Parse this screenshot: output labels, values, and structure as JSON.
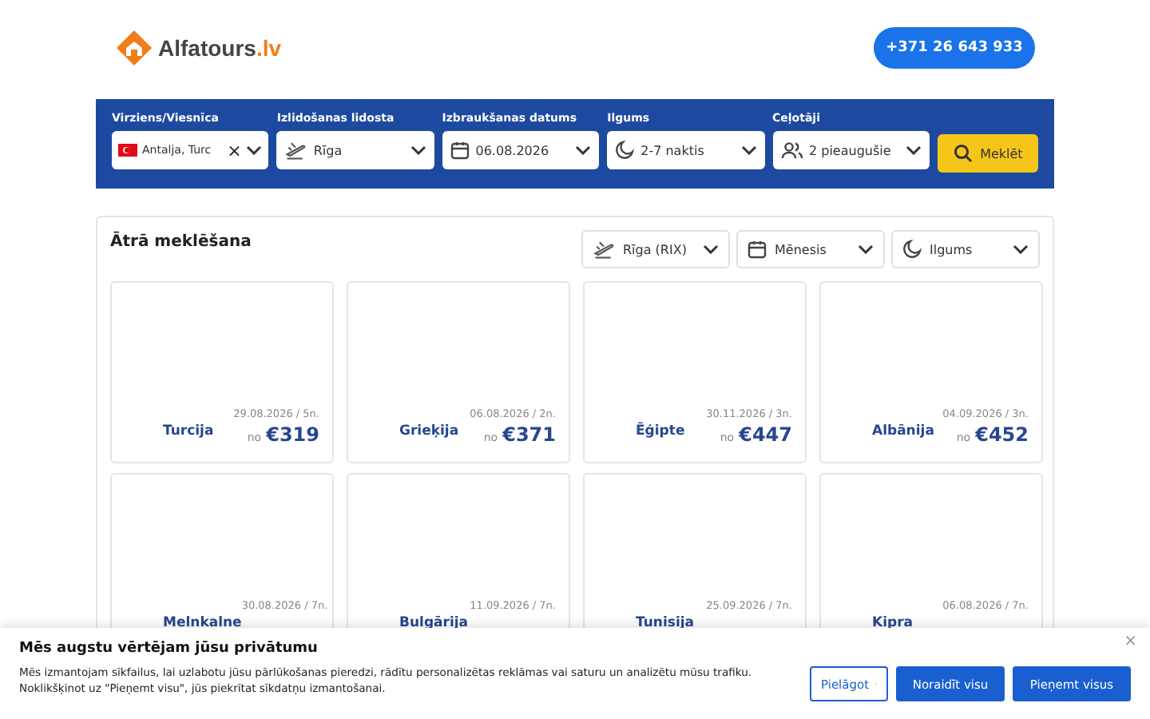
{
  "header": {
    "logo": {
      "name": "Alfatours",
      "suffix": ".lv"
    },
    "phone_button": "+371 26 643 933"
  },
  "search": {
    "fields": [
      {
        "kind": "destination",
        "label": "Virziens/Viesnīca",
        "value": "Antalja, Turc",
        "clear": "×"
      },
      {
        "kind": "airport",
        "label": "Izlidošanas lidosta",
        "value": "Rīga"
      },
      {
        "kind": "date",
        "label": "Izbraukšanas datums",
        "value": "06.08.2026"
      },
      {
        "kind": "duration",
        "label": "Ilgums",
        "value": "2-7 naktis"
      },
      {
        "kind": "travelers",
        "label": "Ceļotāji",
        "value": "2 pieaugušie"
      }
    ],
    "button": "Meklēt"
  },
  "quick_search": {
    "title": "Ātrā meklēšana",
    "filters": [
      {
        "kind": "airport",
        "value": "Rīga (RIX)"
      },
      {
        "kind": "date",
        "value": "Mēnesis"
      },
      {
        "kind": "duration",
        "value": "Ilgums"
      }
    ],
    "destinations": [
      {
        "name": "Turcija",
        "date": "29.08.2026 / 5n.",
        "from": "no",
        "price": "€319"
      },
      {
        "name": "Grieķija",
        "date": "06.08.2026 / 2n.",
        "from": "no",
        "price": "€371"
      },
      {
        "name": "Ēģipte",
        "date": "30.11.2026 / 3n.",
        "from": "no",
        "price": "€447"
      },
      {
        "name": "Albānija",
        "date": "04.09.2026 / 3n.",
        "from": "no",
        "price": "€452"
      },
      {
        "name": "Melnkalne",
        "date": "30.08.2026 / 7n."
      },
      {
        "name": "Bulgārija",
        "date": "11.09.2026 / 7n."
      },
      {
        "name": "Tunisija",
        "date": "25.09.2026 / 7n."
      },
      {
        "name": "Kipra",
        "date": "06.08.2026 / 7n."
      }
    ]
  },
  "cookie_banner": {
    "title": "Mēs augstu vērtējam jūsu privātumu",
    "text": "Mēs izmantojam sīkfailus, lai uzlabotu jūsu pārlūkošanas pieredzi, rādītu personalizētas reklāmas vai saturu un analizētu mūsu trafiku. Noklikšķinot uz \"Pieņemt visu\", jūs piekrītat sīkdatņu izmantošanai.",
    "close": "×",
    "buttons": [
      {
        "kind": "dropdown",
        "label": "Pielāgot"
      },
      {
        "kind": "primary",
        "label": "Noraidīt visu"
      },
      {
        "kind": "primary",
        "label": "Pieņemt visus"
      }
    ]
  }
}
